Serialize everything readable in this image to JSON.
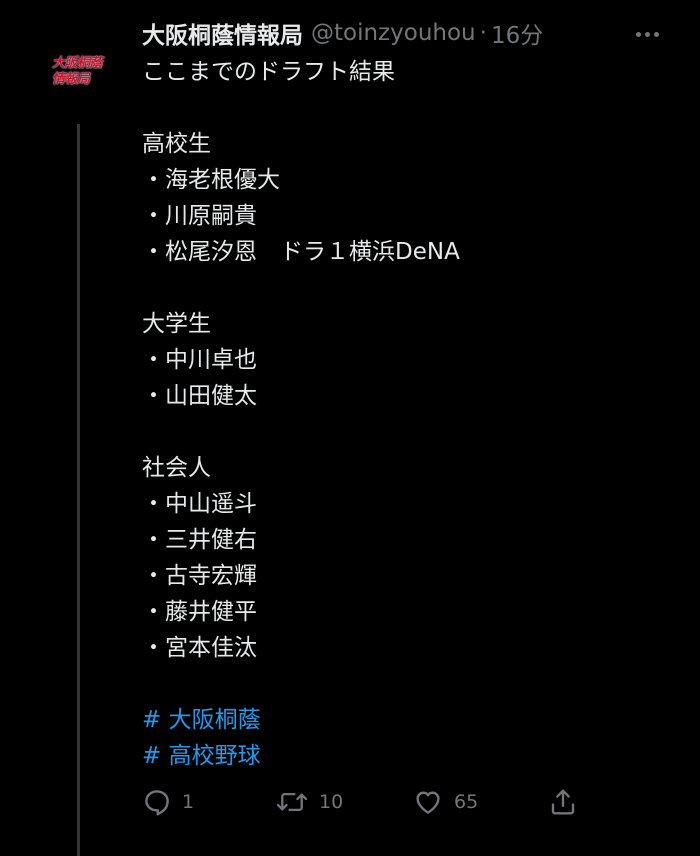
{
  "account": {
    "avatar_text_line1": "大阪桐蔭",
    "avatar_text_line2": "情報局",
    "display_name": "大阪桐蔭情報局",
    "handle": "@toinzyouhou",
    "separator": "·",
    "time": "16分"
  },
  "tweet": {
    "intro": "ここまでのドラフト結果",
    "sections": [
      {
        "heading": "高校生",
        "players": [
          "・海老根優大",
          "・川原嗣貴",
          "・松尾汐恩　ドラ１横浜DeNA"
        ]
      },
      {
        "heading": "大学生",
        "players": [
          "・中川卓也",
          "・山田健太"
        ]
      },
      {
        "heading": "社会人",
        "players": [
          "・中山遥斗",
          "・三井健右",
          "・古寺宏輝",
          "・藤井健平",
          "・宮本佳汰"
        ]
      }
    ],
    "hashtags": [
      "# 大阪桐蔭",
      "# 高校野球"
    ]
  },
  "actions": {
    "reply_count": "1",
    "retweet_count": "10",
    "like_count": "65"
  },
  "colors": {
    "background": "#000000",
    "text": "#e7e9ea",
    "muted": "#71767b",
    "hashtag": "#1d9bf0"
  }
}
